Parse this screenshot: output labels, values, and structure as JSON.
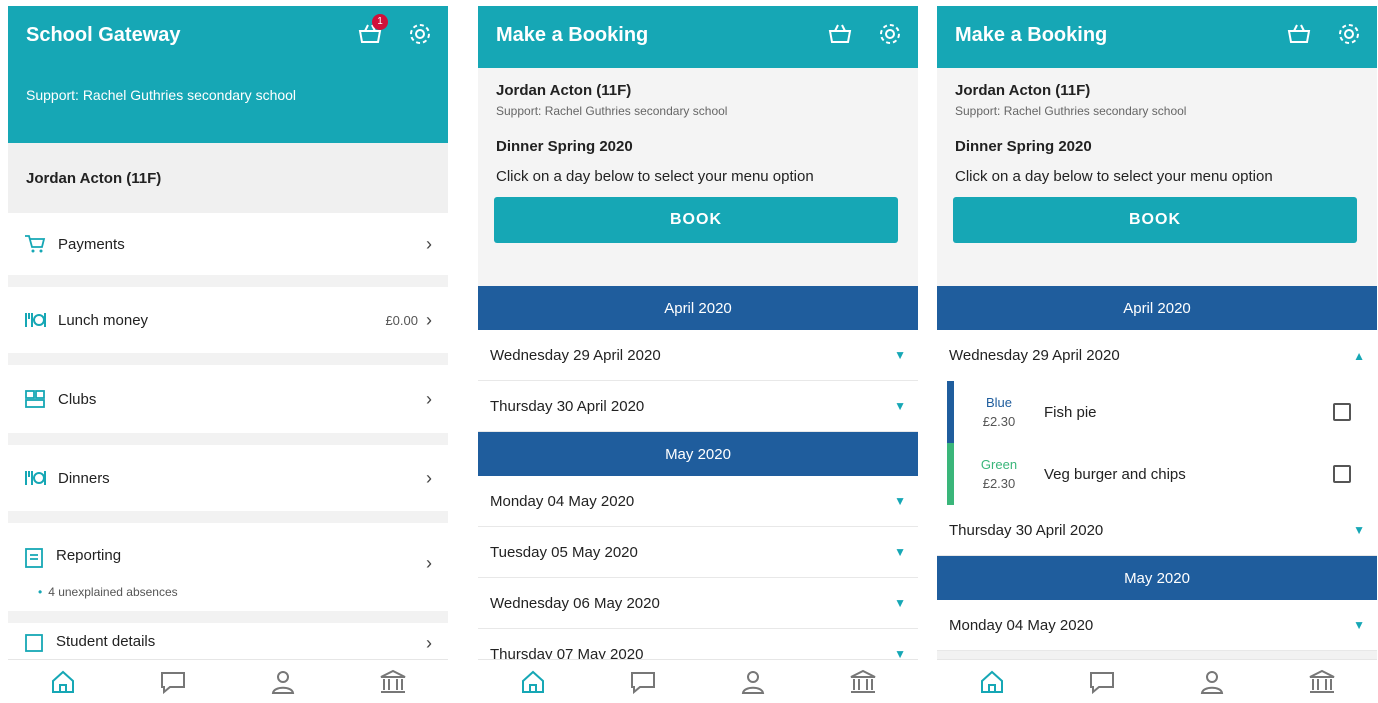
{
  "colors": {
    "teal": "#16a7b5",
    "navy": "#1f5d9d",
    "blue_option": "#1f5d9d",
    "green_option": "#3ab67a",
    "badge": "#d0103a"
  },
  "screen1": {
    "title": "School Gateway",
    "basket_badge": "1",
    "support": "Support: Rachel Guthries secondary school",
    "student": "Jordan Acton (11F)",
    "menu": [
      {
        "icon": "cart-icon",
        "label": "Payments",
        "value": ""
      },
      {
        "icon": "cutlery-icon",
        "label": "Lunch money",
        "value": "£0.00"
      },
      {
        "icon": "clubs-icon",
        "label": "Clubs",
        "value": ""
      },
      {
        "icon": "cutlery-icon",
        "label": "Dinners",
        "value": ""
      },
      {
        "icon": "report-icon",
        "label": "Reporting",
        "value": "",
        "note": "4 unexplained absences"
      },
      {
        "icon": "id-card-icon",
        "label": "Student details",
        "value": ""
      }
    ]
  },
  "booking": {
    "title": "Make a Booking",
    "student": "Jordan Acton (11F)",
    "support": "Support: Rachel Guthries secondary school",
    "period": "Dinner Spring 2020",
    "instruction": "Click on a day below to select your menu option",
    "book_label": "BOOK",
    "month_april": "April 2020",
    "month_may": "May 2020",
    "days_april": [
      "Wednesday 29 April 2020",
      "Thursday 30 April 2020"
    ],
    "days_may": [
      "Monday 04 May 2020",
      "Tuesday 05 May 2020",
      "Wednesday 06 May 2020",
      "Thursday 07 May 2020"
    ]
  },
  "options": [
    {
      "name": "Blue",
      "price": "£2.30",
      "meal": "Fish pie"
    },
    {
      "name": "Green",
      "price": "£2.30",
      "meal": "Veg burger and chips"
    }
  ],
  "nav": [
    "home-icon",
    "message-icon",
    "profile-icon",
    "school-icon"
  ]
}
